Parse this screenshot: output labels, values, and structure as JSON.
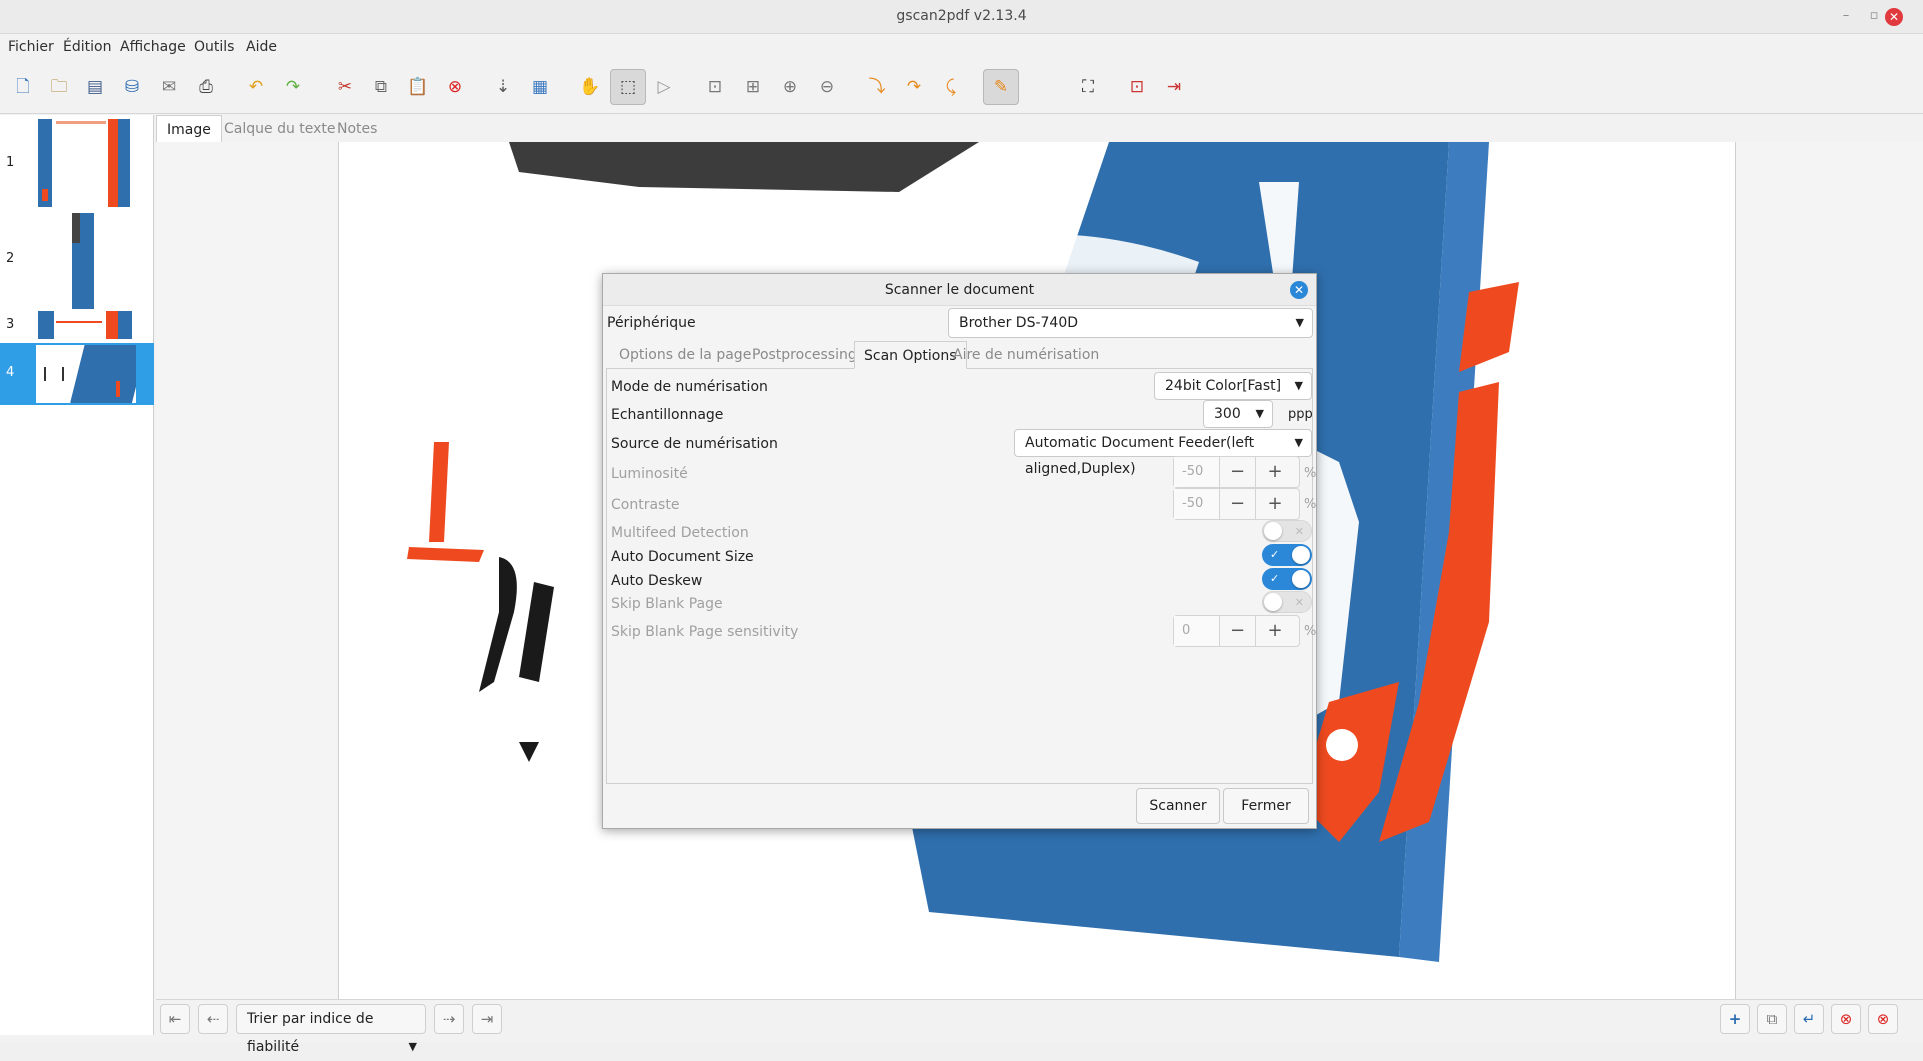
{
  "window": {
    "title": "gscan2pdf v2.13.4",
    "minimize_glyph": "–",
    "maximize_glyph": "▫",
    "close_glyph": "✕"
  },
  "menubar": {
    "items": [
      "Fichier",
      "Édition",
      "Affichage",
      "Outils",
      "Aide"
    ]
  },
  "toolbar": {
    "icons": [
      "new-document-icon",
      "open-folder-icon",
      "scan-icon",
      "save-icon",
      "email-icon",
      "print-icon",
      "undo-icon",
      "redo-icon",
      "cut-icon",
      "copy-icon",
      "paste-icon",
      "delete-icon",
      "renumber-icon",
      "select-all-icon",
      "pan-tool-icon",
      "select-tool-icon",
      "play-icon",
      "zoom-100-icon",
      "zoom-fit-icon",
      "zoom-in-icon",
      "zoom-out-icon",
      "rotate-90-icon",
      "rotate-180-icon",
      "rotate-270-icon",
      "edit-text-icon",
      "crop-icon",
      "unpaper-icon",
      "quit-icon"
    ]
  },
  "thumbnails": {
    "pages": [
      "1",
      "2",
      "3",
      "4"
    ],
    "selected_index": 3
  },
  "tabs": {
    "items": [
      "Image",
      "Calque du texte",
      "Notes"
    ],
    "active": 0
  },
  "bottom": {
    "sort_label": "Trier par indice de fiabilité",
    "dropdown_glyph": "▼"
  },
  "dialog": {
    "title": "Scanner le document",
    "device_label": "Périphérique",
    "device_value": "Brother DS-740D",
    "tabs": [
      "Options de la page",
      "Postprocessing",
      "Scan Options",
      "Aire de numérisation"
    ],
    "active_tab": 2,
    "scan_mode_label": "Mode de numérisation",
    "scan_mode_value": "24bit Color[Fast]",
    "resolution_label": "Echantillonnage",
    "resolution_value": "300",
    "resolution_unit": "ppp",
    "source_label": "Source de numérisation",
    "source_value": "Automatic Document Feeder(left aligned,Duplex)",
    "brightness_label": "Luminosité",
    "brightness_value": "-50",
    "brightness_unit": "%",
    "contrast_label": "Contraste",
    "contrast_value": "-50",
    "contrast_unit": "%",
    "multifeed_label": "Multifeed Detection",
    "multifeed_on": false,
    "autosize_label": "Auto Document Size",
    "autosize_on": true,
    "autodeskew_label": "Auto Deskew",
    "autodeskew_on": true,
    "skipblank_label": "Skip Blank Page",
    "skipblank_on": false,
    "skipsens_label": "Skip Blank Page sensitivity",
    "skipsens_value": "0",
    "skipsens_unit": "%",
    "scan_button": "Scanner",
    "close_button": "Fermer"
  },
  "colors": {
    "accent": "#2b88d8",
    "selection": "#2f9ee6",
    "scan_blue": "#2f6fad",
    "scan_orange": "#ef4a1f",
    "danger": "#e0393e"
  }
}
